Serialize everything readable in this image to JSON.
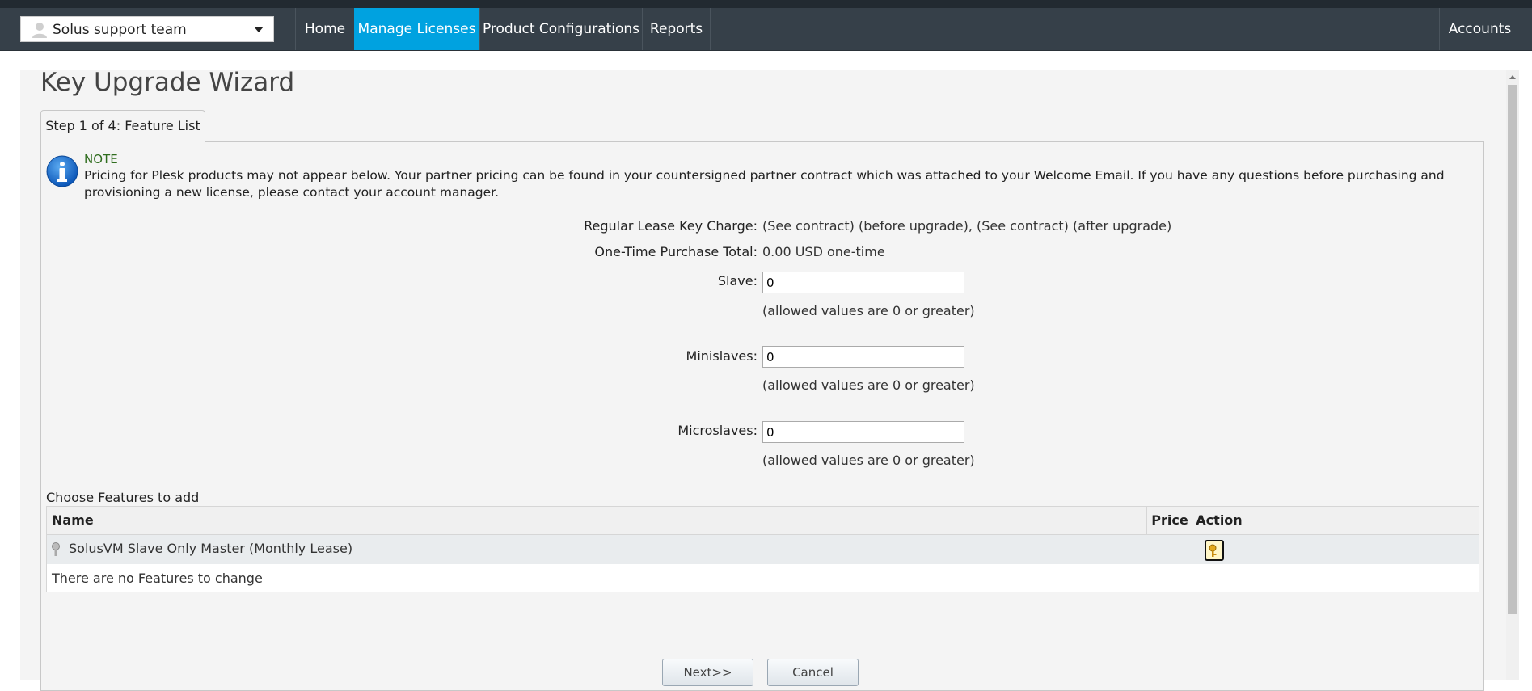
{
  "navbar": {
    "account_selector": "Solus support team",
    "items": [
      {
        "label": "Home",
        "active": false
      },
      {
        "label": "Manage Licenses",
        "active": true
      },
      {
        "label": "Product Configurations",
        "active": false
      },
      {
        "label": "Reports",
        "active": false
      }
    ],
    "accounts_label": "Accounts",
    "active_color": "#00a2e0",
    "bar_color": "#364049"
  },
  "page": {
    "title": "Key Upgrade Wizard",
    "tab_label": "Step 1 of 4: Feature List"
  },
  "note": {
    "icon": "info-icon",
    "title": "NOTE",
    "text": "Pricing for Plesk products may not appear below. Your partner pricing can be found in your countersigned partner contract which was attached to your Welcome Email. If you have any questions before purchasing and provisioning a new license, please contact your account manager."
  },
  "form": {
    "lease_label": "Regular Lease Key Charge:",
    "lease_value": "(See contract) (before upgrade), (See contract) (after upgrade)",
    "purchase_label": "One-Time Purchase Total:",
    "purchase_value": "0.00 USD one-time",
    "slave_label": "Slave:",
    "slave_value": "0",
    "slave_hint": "(allowed values are 0 or greater)",
    "minislaves_label": "Minislaves:",
    "minislaves_value": "0",
    "minislaves_hint": "(allowed values are 0 or greater)",
    "microslaves_label": "Microslaves:",
    "microslaves_value": "0",
    "microslaves_hint": "(allowed values are 0 or greater)"
  },
  "features": {
    "section_label": "Choose Features to add",
    "columns": [
      "Name",
      "Price",
      "Action"
    ],
    "rows": [
      {
        "icon": "key-icon",
        "name": "SolusVM Slave Only Master (Monthly Lease)",
        "price": "",
        "action_icon": "upgrade-key-icon"
      }
    ],
    "empty_message": "There are no Features to change"
  },
  "buttons": {
    "next": "Next>>",
    "cancel": "Cancel"
  }
}
